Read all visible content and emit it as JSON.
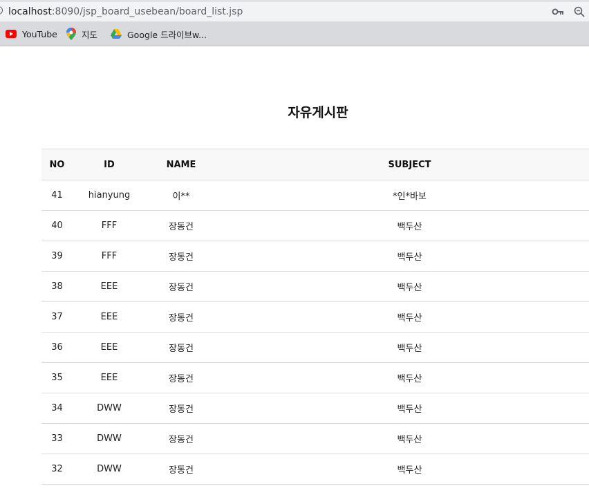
{
  "browser": {
    "url_host": "localhost",
    "url_path": ":8090/jsp_board_usebean/board_list.jsp",
    "bookmarks": [
      {
        "label": "YouTube",
        "icon": "youtube-icon"
      },
      {
        "label": "지도",
        "icon": "maps-pin-icon"
      },
      {
        "label": "Google 드라이브w...",
        "icon": "drive-icon"
      }
    ],
    "icons": {
      "key": "key-icon",
      "zoom": "zoom-icon"
    }
  },
  "board": {
    "title": "자유게시판",
    "headers": {
      "no": "NO",
      "id": "ID",
      "name": "NAME",
      "subject": "SUBJECT"
    },
    "rows": [
      {
        "no": "41",
        "id": "hianyung",
        "name": "이**",
        "subject": "*인*바보"
      },
      {
        "no": "40",
        "id": "FFF",
        "name": "장동건",
        "subject": "백두산"
      },
      {
        "no": "39",
        "id": "FFF",
        "name": "장동건",
        "subject": "백두산"
      },
      {
        "no": "38",
        "id": "EEE",
        "name": "장동건",
        "subject": "백두산"
      },
      {
        "no": "37",
        "id": "EEE",
        "name": "장동건",
        "subject": "백두산"
      },
      {
        "no": "36",
        "id": "EEE",
        "name": "장동건",
        "subject": "백두산"
      },
      {
        "no": "35",
        "id": "EEE",
        "name": "장동건",
        "subject": "백두산"
      },
      {
        "no": "34",
        "id": "DWW",
        "name": "장동건",
        "subject": "백두산"
      },
      {
        "no": "33",
        "id": "DWW",
        "name": "장동건",
        "subject": "백두산"
      },
      {
        "no": "32",
        "id": "DWW",
        "name": "장동건",
        "subject": "백두산"
      }
    ]
  },
  "colors": {
    "youtube_red": "#ff0000",
    "header_bg": "#f8f8f8",
    "row_border": "#dddddd"
  }
}
